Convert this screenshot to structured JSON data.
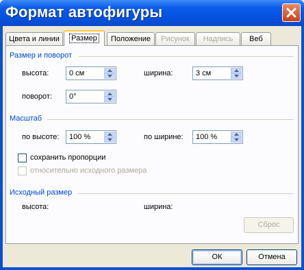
{
  "window": {
    "title": "Формат автофигуры"
  },
  "tabs": [
    {
      "label": "Цвета и линии",
      "state": "normal"
    },
    {
      "label": "Размер",
      "state": "active"
    },
    {
      "label": "Положение",
      "state": "normal"
    },
    {
      "label": "Рисунок",
      "state": "disabled"
    },
    {
      "label": "Надпись",
      "state": "disabled"
    },
    {
      "label": "Веб",
      "state": "normal"
    }
  ],
  "size_rotation": {
    "heading": "Размер и поворот",
    "height_label": "высота:",
    "height_value": "0 см",
    "width_label": "ширина:",
    "width_value": "3 см",
    "rotation_label": "поворот:",
    "rotation_value": "0°"
  },
  "scale": {
    "heading": "Масштаб",
    "height_label": "по высоте:",
    "height_value": "100 %",
    "width_label": "по ширине:",
    "width_value": "100 %",
    "lock_aspect_label": "сохранить пропорции",
    "relative_label": "относительно исходного размера"
  },
  "original": {
    "heading": "Исходный размер",
    "height_label": "высота:",
    "width_label": "ширина:",
    "reset_label": "Сброс"
  },
  "footer": {
    "ok_label": "ОК",
    "cancel_label": "Отмена"
  },
  "colors": {
    "title_bar": "#0A4FD8",
    "section_heading": "#0046D5",
    "active_tab_accent": "#FFC83C"
  }
}
